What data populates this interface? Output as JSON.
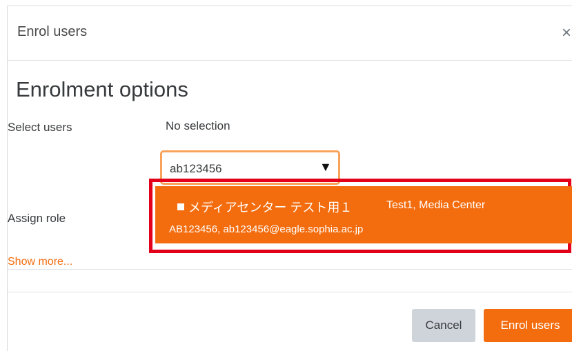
{
  "dialog": {
    "title": "Enrol users",
    "close_icon": "×"
  },
  "form": {
    "heading": "Enrolment options",
    "select_users_label": "Select users",
    "selection_status": "No selection",
    "search_value": "ab123456",
    "dropdown_arrow": "▼",
    "assign_role_label": "Assign role",
    "show_more_label": "Show more..."
  },
  "suggestion": {
    "name_jp": "メディアセンター テスト用１",
    "full_name": "Test1, Media Center",
    "detail": "AB123456, ab123456@eagle.sophia.ac.jp"
  },
  "footer": {
    "cancel_label": "Cancel",
    "enrol_label": "Enrol users"
  },
  "colors": {
    "accent": "#f36c0d",
    "highlight": "#e3001b",
    "focus_border": "#f9a35a",
    "cancel_bg": "#ced4da"
  }
}
